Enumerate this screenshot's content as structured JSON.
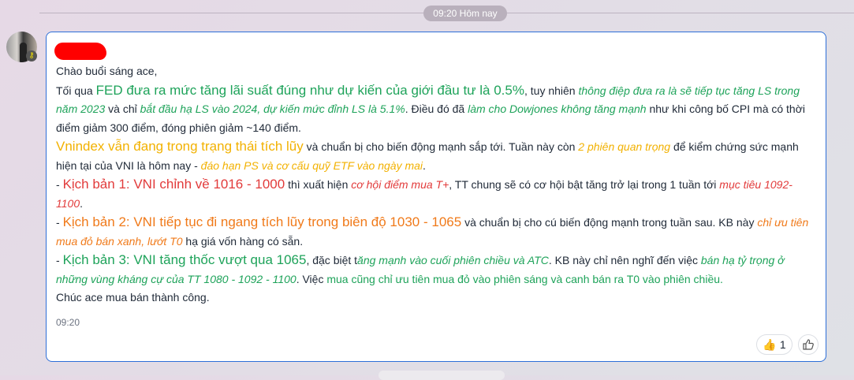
{
  "date_separator": "09:20 Hôm nay",
  "message": {
    "time": "09:20",
    "reaction": {
      "emoji": "👍",
      "count": "1"
    },
    "paragraphs": [
      [
        {
          "t": "Chào buổi sáng ace,",
          "c": ""
        }
      ],
      [
        {
          "t": "Tối qua ",
          "c": ""
        },
        {
          "t": "FED đưa ra mức tăng lãi suất đúng như dự kiến của giới đầu tư là 0.5%",
          "c": "g big"
        },
        {
          "t": ", tuy nhiên ",
          "c": ""
        },
        {
          "t": "thông điệp đưa ra là sẽ tiếp tục tăng LS trong năm 2023",
          "c": "g it"
        },
        {
          "t": " và chỉ ",
          "c": ""
        },
        {
          "t": "bắt đầu hạ LS vào 2024, dự kiến mức đỉnh LS là 5.1%",
          "c": "g it"
        },
        {
          "t": ". Điều đó đã ",
          "c": ""
        },
        {
          "t": "làm cho Dowjones không tăng mạnh",
          "c": "g it"
        },
        {
          "t": " như khi công bố CPI mà có thời điểm giảm 300 điểm, đóng phiên giảm ~140 điểm.",
          "c": ""
        }
      ],
      [
        {
          "t": "Vnindex vẫn đang trong trạng thái tích lũy",
          "c": "y big"
        },
        {
          "t": " và chuẩn bị cho biến động mạnh sắp tới. Tuần này còn ",
          "c": ""
        },
        {
          "t": "2 phiên quan trọng",
          "c": "y it"
        },
        {
          "t": " để kiểm chứng sức mạnh hiện tại của VNI là hôm nay - ",
          "c": ""
        },
        {
          "t": "đáo hạn PS và cơ cấu quỹ ETF vào ngày mai",
          "c": "y it"
        },
        {
          "t": ".",
          "c": ""
        }
      ],
      [
        {
          "t": "- ",
          "c": ""
        },
        {
          "t": "Kịch bản 1: VNI chỉnh về 1016 - 1000",
          "c": "r big"
        },
        {
          "t": " thì xuất hiện ",
          "c": ""
        },
        {
          "t": "cơ hội điểm mua T+",
          "c": "r it"
        },
        {
          "t": ", TT chung sẽ có cơ hội bật tăng trở lại trong 1 tuần tới ",
          "c": ""
        },
        {
          "t": "mục tiêu 1092-1100",
          "c": "r it"
        },
        {
          "t": ".",
          "c": ""
        }
      ],
      [
        {
          "t": "- ",
          "c": ""
        },
        {
          "t": "Kịch bản 2: VNI tiếp tục đi ngang tích lũy trong biên độ 1030 - 1065",
          "c": "o big"
        },
        {
          "t": " và chuẩn bị cho cú biến động mạnh trong tuần sau. KB này ",
          "c": ""
        },
        {
          "t": "chỉ ưu tiên mua đỏ bán xanh, lướt T0",
          "c": "o it"
        },
        {
          "t": " hạ giá vốn hàng có sẵn.",
          "c": ""
        }
      ],
      [
        {
          "t": "- ",
          "c": ""
        },
        {
          "t": "Kịch bản 3: VNI tăng thốc vượt qua 1065",
          "c": "g big"
        },
        {
          "t": ", đặc biệt t",
          "c": ""
        },
        {
          "t": "ăng mạnh vào cuối phiên chiều và ATC",
          "c": "g it"
        },
        {
          "t": ". KB này chỉ nên nghĩ đến việc ",
          "c": ""
        },
        {
          "t": "bán hạ tỷ trọng ở những vùng kháng cự của TT 1080 - 1092 - 1100",
          "c": "g it"
        },
        {
          "t": ". Việc ",
          "c": ""
        },
        {
          "t": "mua cũng chỉ ưu tiên mua đỏ vào phiên sáng và canh bán ra T0 vào phiên chiều.",
          "c": "g"
        }
      ],
      [
        {
          "t": "Chúc ace mua bán thành công.",
          "c": ""
        }
      ]
    ]
  },
  "colors": {
    "green": "#1ea35a",
    "yellow": "#f2b100",
    "red": "#e23b3b",
    "orange": "#f07a1a",
    "border": "#2d6fd8"
  }
}
